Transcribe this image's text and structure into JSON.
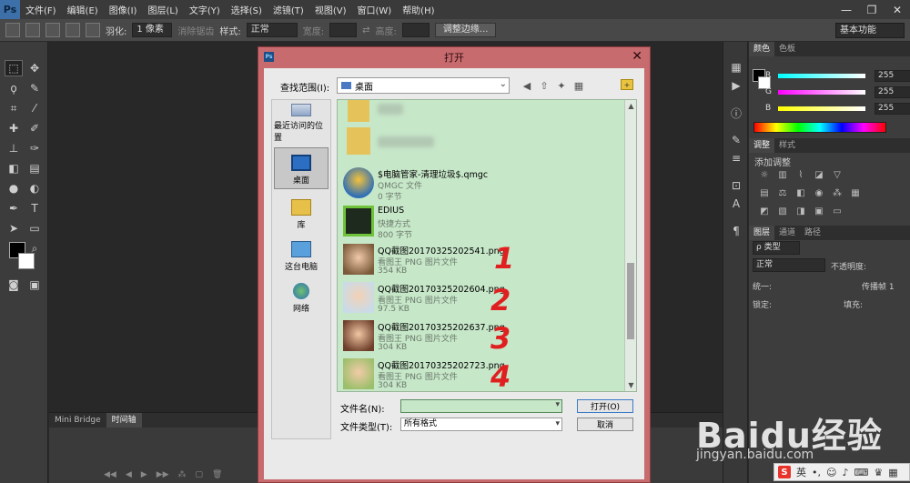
{
  "app": {
    "logo": "Ps",
    "menu": [
      "文件(F)",
      "编辑(E)",
      "图像(I)",
      "图层(L)",
      "文字(Y)",
      "选择(S)",
      "滤镜(T)",
      "视图(V)",
      "窗口(W)",
      "帮助(H)"
    ],
    "window_controls": [
      "—",
      "❐",
      "✕"
    ]
  },
  "options_bar": {
    "feather_label": "羽化:",
    "feather_value": "1 像素",
    "antialias_label": "消除锯齿",
    "style_label": "样式:",
    "style_value": "正常",
    "width_label": "宽度:",
    "height_label": "高度:",
    "refine_edge_label": "调整边缘...",
    "workspace_label": "基本功能"
  },
  "bottom_panel": {
    "tabs": [
      "Mini Bridge",
      "时间轴"
    ]
  },
  "right_panel": {
    "color_tabs": [
      "颜色",
      "色板"
    ],
    "rgb": [
      {
        "channel": "R",
        "value": "255",
        "color": "#ff4040"
      },
      {
        "channel": "G",
        "value": "255",
        "color": "#ff40ff"
      },
      {
        "channel": "B",
        "value": "255",
        "color": "#ffff40"
      }
    ],
    "adjust_tabs": [
      "调整",
      "样式"
    ],
    "adjust_title": "添加调整",
    "layers_tabs": [
      "图层",
      "通道",
      "路径"
    ],
    "kind_label": "ρ 类型",
    "blend_mode": "正常",
    "opacity_label": "不透明度:",
    "lock_label": "锁定:",
    "fill_label": "填充:",
    "unify_label": "统一:",
    "propagate_label": "传播帧 1"
  },
  "dialog": {
    "title": "打开",
    "lookin_label": "查找范围(I):",
    "lookin_value": "桌面",
    "places": [
      "最近访问的位置",
      "桌面",
      "库",
      "这台电脑",
      "网络"
    ],
    "files": [
      {
        "name": "$电脑管家-清理垃圾$.qmgc",
        "type": "QMGC 文件",
        "size": "0 字节"
      },
      {
        "name": "EDIUS",
        "type": "快捷方式",
        "size": "800 字节"
      },
      {
        "name": "QQ截图20170325202541.png",
        "type": "看图王 PNG 图片文件",
        "size": "354 KB"
      },
      {
        "name": "QQ截图20170325202604.png",
        "type": "看图王 PNG 图片文件",
        "size": "97.5 KB"
      },
      {
        "name": "QQ截图20170325202637.png",
        "type": "看图王 PNG 图片文件",
        "size": "304 KB"
      },
      {
        "name": "QQ截图20170325202723.png",
        "type": "看图王 PNG 图片文件",
        "size": "304 KB"
      }
    ],
    "annotations": [
      "1",
      "2",
      "3",
      "4"
    ],
    "filename_label": "文件名(N):",
    "filename_value": "",
    "filetype_label": "文件类型(T):",
    "filetype_value": "所有格式",
    "open_button": "打开(O)",
    "cancel_button": "取消"
  },
  "watermark": {
    "brand": "Baidu经验",
    "url": "jingyan.baidu.com"
  },
  "ime": {
    "lang": "英"
  }
}
